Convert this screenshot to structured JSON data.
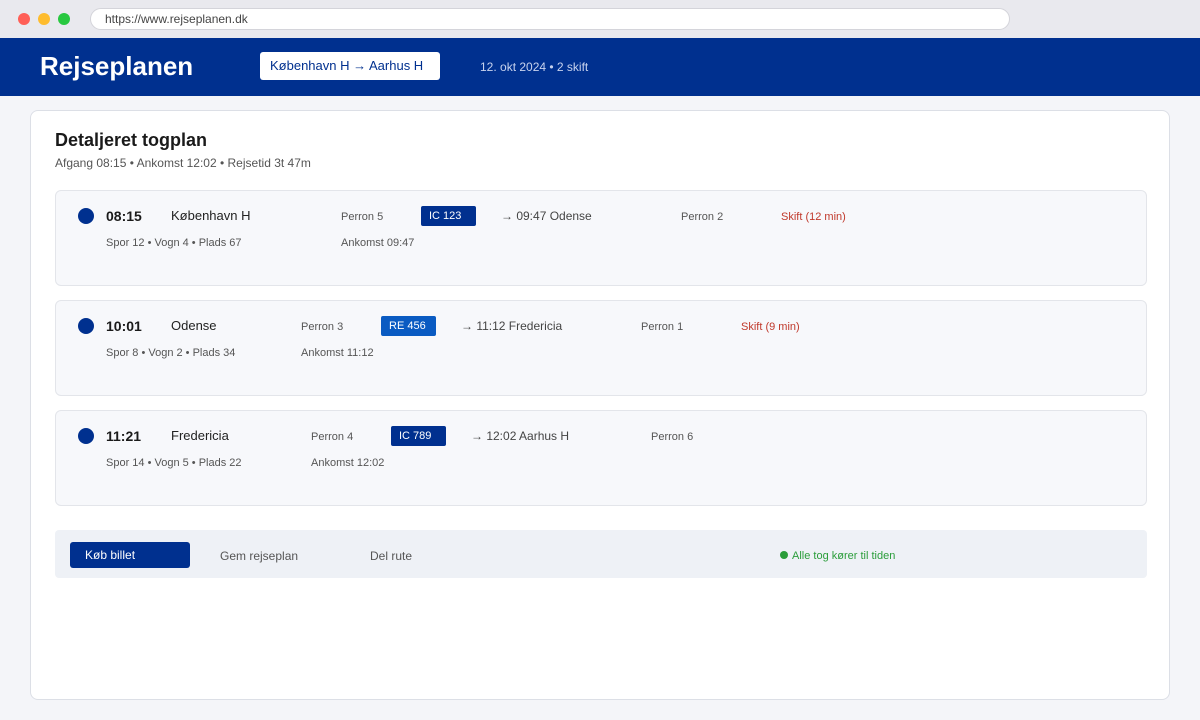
{
  "browser": {
    "url": "https://www.rejseplanen.dk"
  },
  "header": {
    "brand": "Rejseplanen",
    "route": "København H → Aarhus H",
    "meta": "12. okt 2024 • 2 skift"
  },
  "plan": {
    "title": "Detaljeret togplan",
    "subtitle": "Afgang 08:15 • Ankomst 12:02 • Rejsetid 3t 47m"
  },
  "legs": [
    {
      "time": "08:15",
      "station": "København H",
      "seat": "Spor 12 • Vogn 4 • Plads 67",
      "platform": "Perron 5",
      "arrival": "Ankomst 09:47",
      "train": "IC 123",
      "train_color": "#00308f",
      "destination": "→ 09:47 Odense",
      "arr_platform": "Perron 2",
      "transfer": "Skift (12 min)"
    },
    {
      "time": "10:01",
      "station": "Odense",
      "seat": "Spor 8 • Vogn 2 • Plads 34",
      "platform": "Perron 3",
      "arrival": "Ankomst 11:12",
      "train": "RE 456",
      "train_color": "#0a5bc2",
      "destination": "→ 11:12 Fredericia",
      "arr_platform": "Perron 1",
      "transfer": "Skift (9 min)"
    },
    {
      "time": "11:21",
      "station": "Fredericia",
      "seat": "Spor 14 • Vogn 5 • Plads 22",
      "platform": "Perron 4",
      "arrival": "Ankomst 12:02",
      "train": "IC 789",
      "train_color": "#00308f",
      "destination": "→ 12:02 Aarhus H",
      "arr_platform": "Perron 6",
      "transfer": ""
    }
  ],
  "actions": {
    "buy": "Køb billet",
    "save": "Gem rejseplan",
    "share": "Del rute",
    "status": "Alle tog kører til tiden"
  }
}
